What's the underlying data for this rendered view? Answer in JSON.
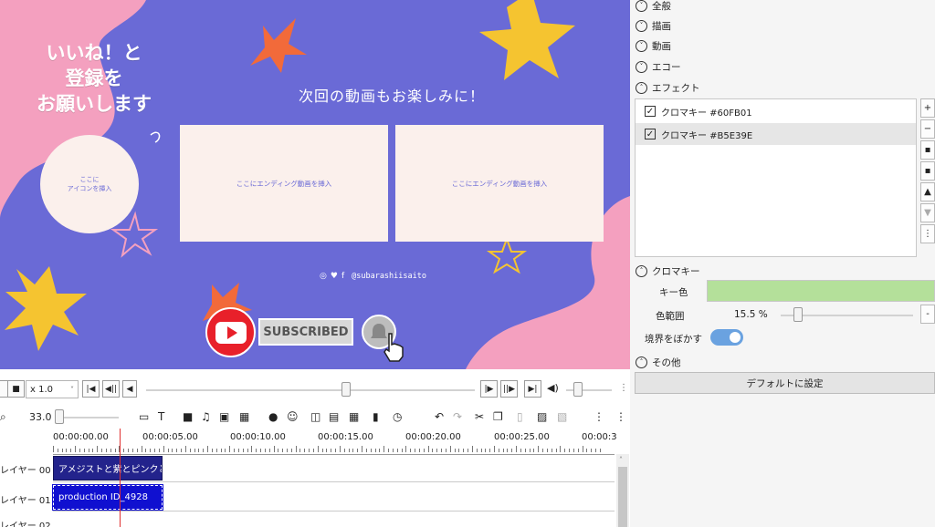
{
  "preview": {
    "left_title_lines": [
      "いいね！と",
      "登録を",
      "お願いします"
    ],
    "icon_placeholder_lines": [
      "ここに",
      "アイコンを挿入"
    ],
    "next_video_title": "次回の動画もお楽しみに！",
    "video_slot_1": "ここにエンディング動画を挿入",
    "video_slot_2": "ここにエンディング動画を挿入",
    "social_icons": [
      "instagram-icon",
      "twitter-icon",
      "facebook-icon"
    ],
    "social_handle": "@subarashiisaito",
    "subscribed_label": "SUBSCRIBED",
    "colors": {
      "background": "#6a6ad6",
      "pink": "#f4a0bf",
      "yellow": "#f5c430",
      "orange": "#f26a3a",
      "cream": "#fbf0ec"
    }
  },
  "playback": {
    "speed": "x 1.0",
    "speed_options_icon": "chevron-down-icon"
  },
  "timeline_toolbar": {
    "zoom_value": "33.0"
  },
  "ruler": {
    "labels": [
      "00:00:00.00",
      "00:00:05.00",
      "00:00:10.00",
      "00:00:15.00",
      "00:00:20.00",
      "00:00:25.00",
      "00:00:3"
    ]
  },
  "layers": [
    {
      "label": "レイヤー 00",
      "clip": "アメジストと紫とピンクと"
    },
    {
      "label": "レイヤー 01",
      "clip": "production ID_4928"
    },
    {
      "label": "レイヤー 02",
      "clip": ""
    }
  ],
  "panel": {
    "sections": [
      "全般",
      "描画",
      "動画",
      "エコー",
      "エフェクト"
    ],
    "effects": [
      {
        "label": "クロマキー #60FB01",
        "checked": true
      },
      {
        "label": "クロマキー #B5E39E",
        "checked": true
      }
    ],
    "chroma_section": "クロマキー",
    "key_color_label": "キー色",
    "key_color": "#b4e09a",
    "range_label": "色範囲",
    "range_value": "15.5 %",
    "blur_edge_label": "境界をぼかす",
    "other_section": "その他",
    "default_button": "デフォルトに設定"
  }
}
